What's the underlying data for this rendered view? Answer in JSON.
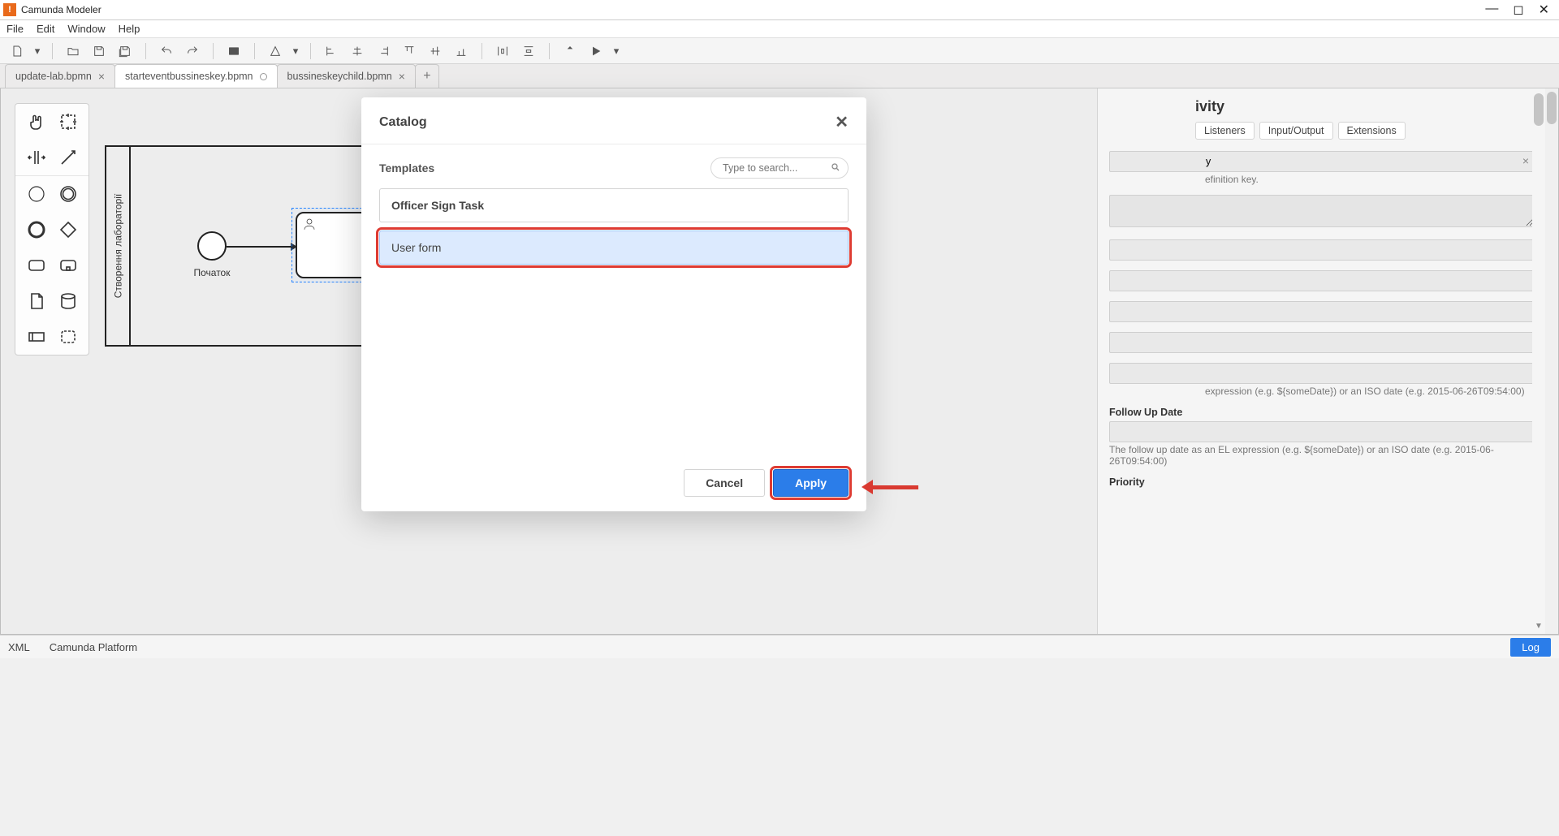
{
  "window": {
    "title": "Camunda Modeler"
  },
  "menubar": [
    "File",
    "Edit",
    "Window",
    "Help"
  ],
  "tabs": [
    {
      "label": "update-lab.bpmn",
      "state": "closed-x"
    },
    {
      "label": "starteventbussineskey.bpmn",
      "state": "dirty",
      "active": true
    },
    {
      "label": "bussineskeychild.bpmn",
      "state": "closed-x"
    }
  ],
  "canvas": {
    "lane_title": "Створення лабораторії",
    "start_event_label": "Початок"
  },
  "props": {
    "heading_suffix": "ivity",
    "subtabs": [
      "Listeners",
      "Input/Output",
      "Extensions"
    ],
    "row_frag1": {
      "value_suffix": "y",
      "hint_suffix": "efinition key."
    },
    "follow_up": {
      "label": "Follow Up Date",
      "value": "",
      "hint_top": "expression (e.g. ${someDate}) or an ISO date (e.g. 2015-06-26T09:54:00)",
      "hint": "The follow up date as an EL expression (e.g. ${someDate}) or an ISO date (e.g. 2015-06-26T09:54:00)"
    },
    "priority": {
      "label": "Priority"
    }
  },
  "modal": {
    "title": "Catalog",
    "section_label": "Templates",
    "search_placeholder": "Type to search...",
    "items": [
      {
        "label": "Officer Sign Task",
        "selected": false
      },
      {
        "label": "User form",
        "selected": true
      }
    ],
    "cancel_label": "Cancel",
    "apply_label": "Apply"
  },
  "status": {
    "left1": "XML",
    "left2": "Camunda Platform",
    "log": "Log"
  }
}
